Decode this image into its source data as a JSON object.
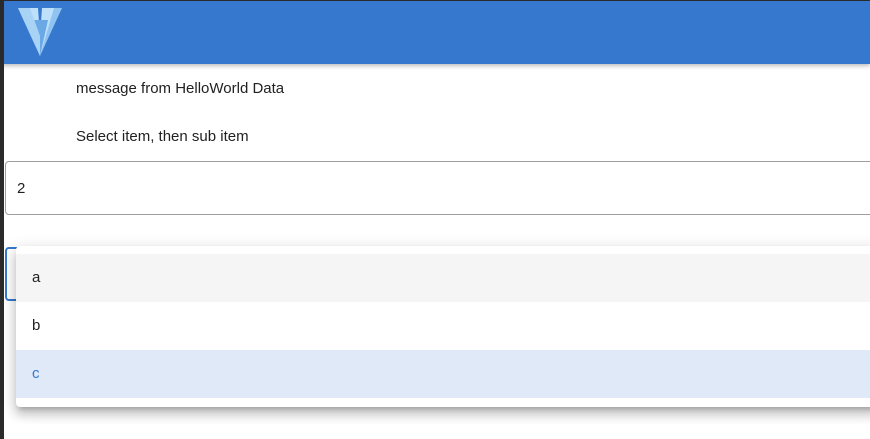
{
  "app_bar": {
    "logo_icon": "vuetify-logo-icon",
    "background_color": "#3578cd"
  },
  "content": {
    "message": "message from HelloWorld Data",
    "instructions": "Select item, then sub item"
  },
  "item_select": {
    "value": "2"
  },
  "subitem_select": {
    "accent_color": "#3578cd",
    "menu": {
      "items": [
        {
          "label": "a",
          "state": "hovered"
        },
        {
          "label": "b",
          "state": "normal"
        },
        {
          "label": "c",
          "state": "selected"
        }
      ],
      "selected_value": "c"
    }
  }
}
